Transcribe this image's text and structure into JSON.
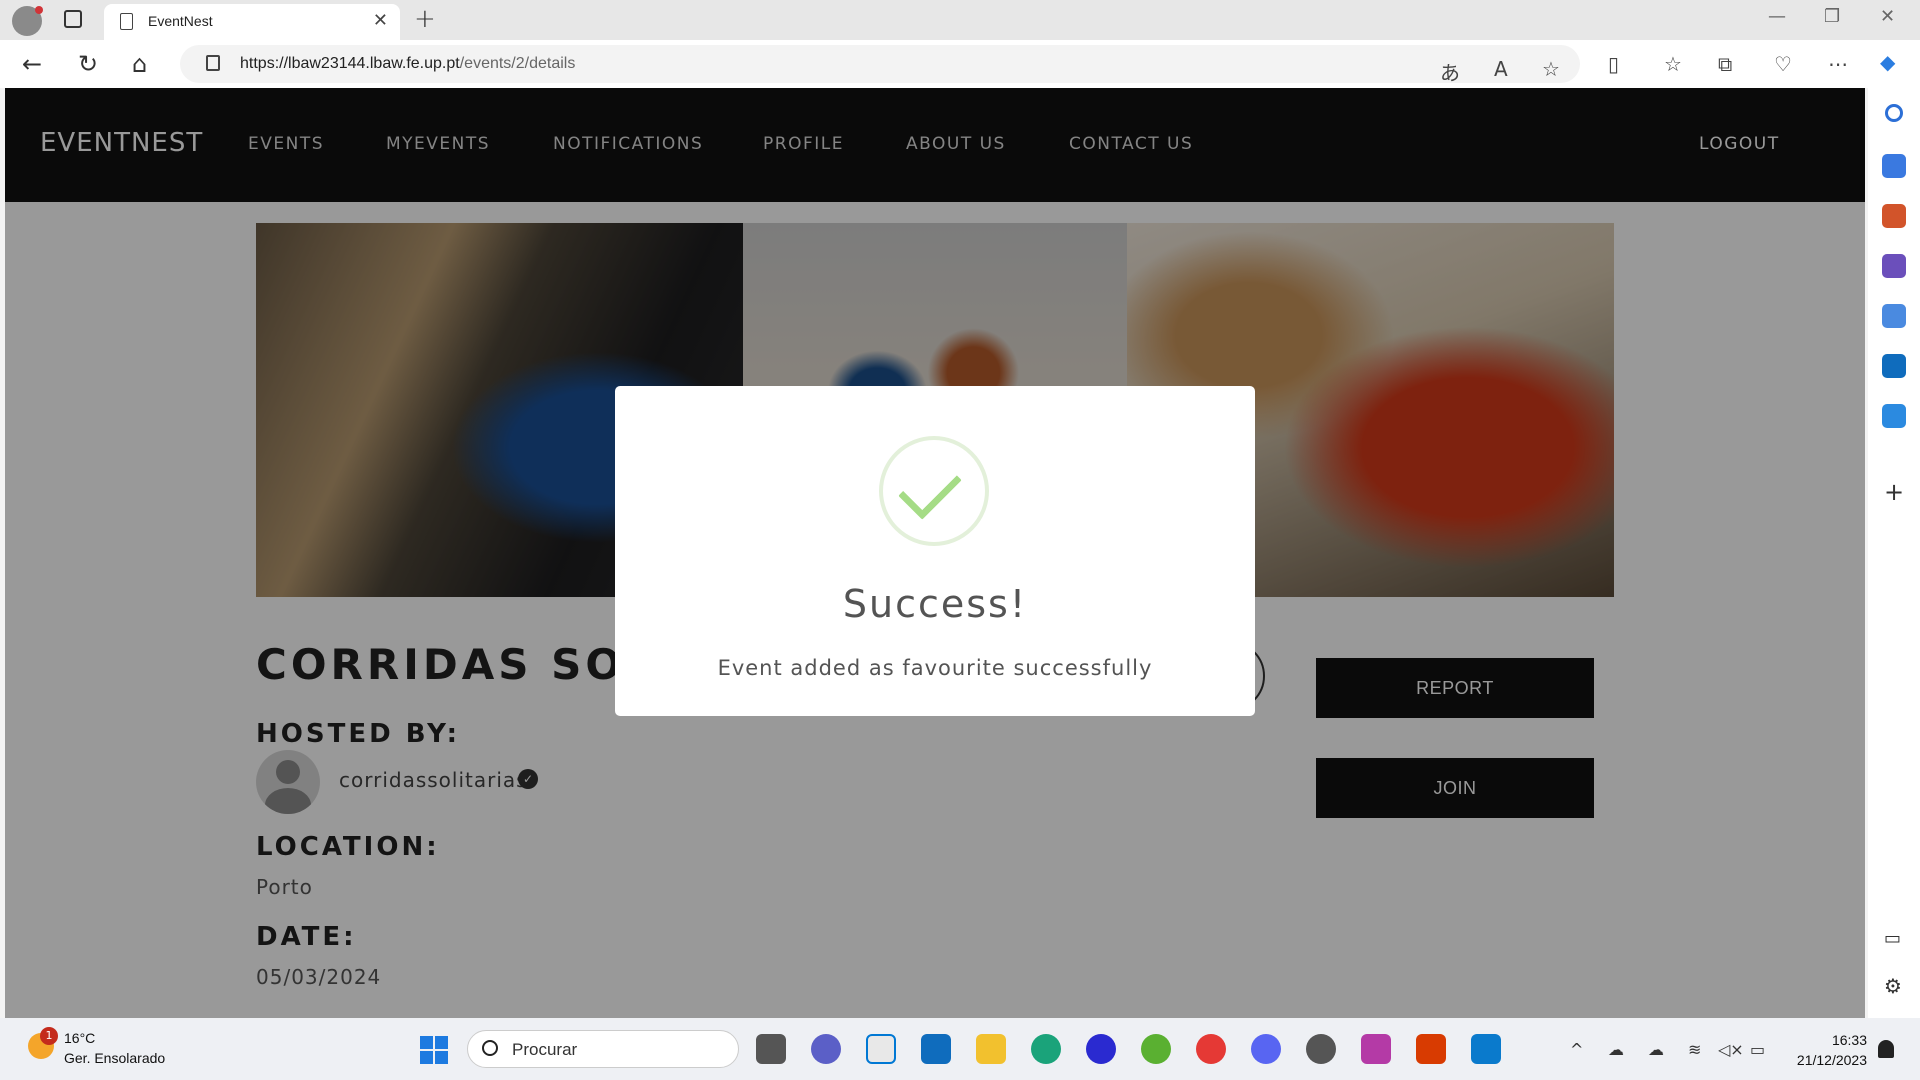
{
  "browser": {
    "tab_title": "EventNest",
    "tab_close": "✕",
    "new_tab": "+",
    "url_host": "https://lbaw23144.lbaw.fe.up.pt",
    "url_path": "/events/2/details"
  },
  "site": {
    "brand": "EVENTNEST",
    "nav": [
      "EVENTS",
      "MYEVENTS",
      "NOTIFICATIONS",
      "PROFILE",
      "ABOUT US",
      "CONTACT US"
    ],
    "logout": "LOGOUT"
  },
  "event": {
    "title": "CORRIDAS SOLITÁRIAS",
    "hosted_by_label": "HOSTED BY:",
    "host_name": "corridassolitarias",
    "location_label": "LOCATION:",
    "location": "Porto",
    "date_label": "DATE:",
    "date": "05/03/2024",
    "report_label": "REPORT",
    "join_label": "JOIN"
  },
  "modal": {
    "title": "Success!",
    "message": "Event added as favourite successfully"
  },
  "taskbar": {
    "temperature": "16°C",
    "weather": "Ger. Ensolarado",
    "weather_badge": "1",
    "search_placeholder": "Procurar",
    "time": "16:33",
    "date": "21/12/2023"
  },
  "colors": {
    "nav_bg": "#111111",
    "success_green": "#a5dc86",
    "button_bg": "#111111"
  }
}
